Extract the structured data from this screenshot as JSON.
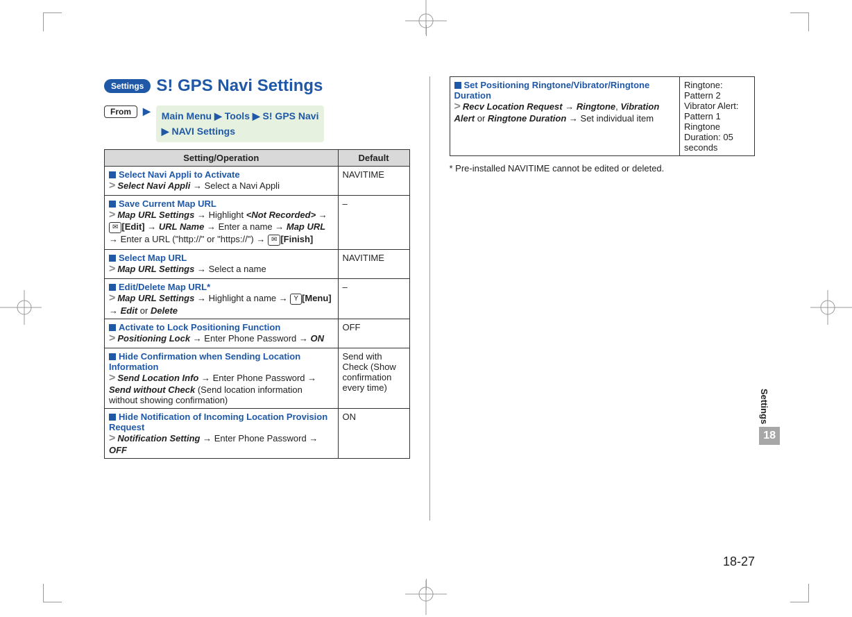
{
  "header": {
    "badge": "Settings",
    "title": "S! GPS Navi Settings",
    "from_label": "From",
    "breadcrumb_html": "Main Menu ▶ Tools ▶ S! GPS Navi ▶ NAVI Settings"
  },
  "table": {
    "col_setting": "Setting/Operation",
    "col_default": "Default",
    "rows": [
      {
        "title": "Select Navi Appli to Activate",
        "body_html": "<span class='gt'>&gt;</span><b><i>Select Navi Appli</i></b> → Select a Navi Appli",
        "def": "NAVITIME"
      },
      {
        "title": "Save Current Map URL",
        "body_html": "<span class='gt'>&gt;</span><b><i>Map URL Settings</i></b> → Highlight <b><i>&lt;Not Recorded&gt;</i></b> → <span class='keycap'>✉</span><b>[Edit]</b> → <b><i>URL Name</i></b> → Enter a name → <b><i>Map URL</i></b> → Enter a URL (\"http://\" or \"https://\") → <span class='keycap'>✉</span><b>[Finish]</b>",
        "def": "–"
      },
      {
        "title": "Select Map URL",
        "body_html": "<span class='gt'>&gt;</span><b><i>Map URL Settings</i></b> → Select a name",
        "def": "NAVITIME"
      },
      {
        "title": "Edit/Delete Map URL*",
        "body_html": "<span class='gt'>&gt;</span><b><i>Map URL Settings</i></b> → Highlight a name → <span class='keycap'>Y</span><b>[Menu]</b> → <b><i>Edit</i></b> or <b><i>Delete</i></b>",
        "def": "–"
      },
      {
        "title": "Activate to Lock Positioning Function",
        "body_html": "<span class='gt'>&gt;</span><b><i>Positioning Lock</i></b> → Enter Phone Password → <b><i>ON</i></b>",
        "def": "OFF"
      },
      {
        "title": "Hide Confirmation when Sending Location Information",
        "body_html": "<span class='gt'>&gt;</span><b><i>Send Location Info</i></b> → Enter Phone Password → <b><i>Send without Check</i></b> (Send location information without showing confirmation)",
        "def": "Send with Check (Show confirmation every time)"
      },
      {
        "title": "Hide Notification of Incoming Location Provision Request",
        "body_html": "<span class='gt'>&gt;</span><b><i>Notification Setting</i></b> → Enter Phone Password → <b><i>OFF</i></b>",
        "def": "ON"
      }
    ]
  },
  "right_row": {
    "title": "Set Positioning Ringtone/Vibrator/Ringtone Duration",
    "body_html": "<span class='gt'>&gt;</span><b><i>Recv Location Request</i></b> → <b><i>Ringtone</i></b>, <b><i>Vibration Alert</i></b> or <b><i>Ringtone Duration</i></b> → Set individual item",
    "def": "Ringtone: Pattern 2\nVibrator Alert: Pattern 1\nRingtone Duration: 05 seconds"
  },
  "footnote": "* Pre-installed NAVITIME cannot be edited or deleted.",
  "side": {
    "label": "Settings",
    "chapter": "18"
  },
  "page_number": "18-27"
}
